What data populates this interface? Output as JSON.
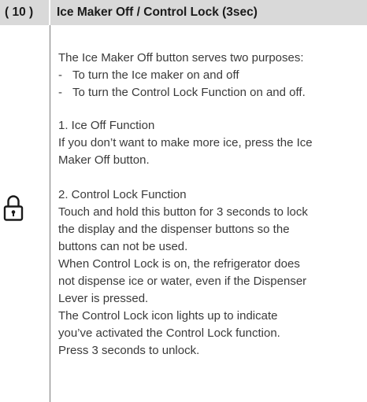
{
  "header": {
    "number": "( 10 )",
    "title": "Ice Maker Off / Control Lock (3sec)"
  },
  "icon": "lock-icon",
  "intro": "The Ice Maker Off button serves two purposes:",
  "purposes": [
    "To turn the Ice maker on and off",
    "To turn the Control Lock Function on and off."
  ],
  "bullet_mark": "-",
  "section1": {
    "heading": "1.  Ice Off Function",
    "lines": [
      "If you don’t want to make more ice, press the Ice",
      "Maker Off button."
    ]
  },
  "section2": {
    "heading": "2.  Control Lock Function",
    "lines": [
      "Touch and hold this button for 3 seconds to lock",
      "the display and the dispenser buttons so the",
      "buttons can not be used.",
      "When Control Lock is on, the refrigerator does",
      "not dispense ice or water, even if the Dispenser",
      "Lever is pressed.",
      "The Control Lock icon lights up to indicate",
      "you’ve activated the Control Lock function.",
      "Press 3 seconds to unlock."
    ]
  },
  "colors": {
    "header_bg": "#d9d9d9",
    "text": "#3a3a3a",
    "divider": "#7a7a7a"
  }
}
